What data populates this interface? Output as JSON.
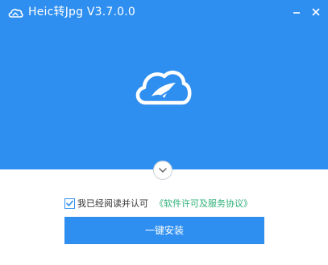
{
  "window": {
    "title": "Heic转Jpg V3.7.0.0",
    "app_icon": "cloud-icon",
    "minimize_icon": "minimize-icon",
    "close_icon": "close-icon"
  },
  "hero": {
    "logo_icon": "cloud-logo-icon"
  },
  "expand": {
    "icon": "chevron-down-icon"
  },
  "agreement": {
    "checked": true,
    "text": "我已经阅读并认可",
    "link_text": "《软件许可及服务协议》"
  },
  "install": {
    "label": "一键安装"
  },
  "colors": {
    "primary": "#2f8ff0",
    "link": "#2fb079",
    "text": "#333333"
  }
}
